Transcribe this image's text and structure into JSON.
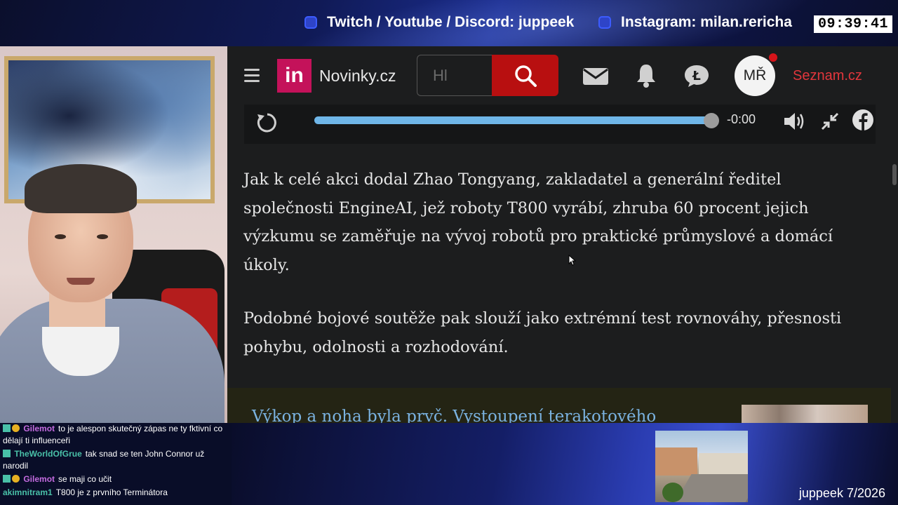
{
  "overlay": {
    "social_twitch": "Twitch / Youtube / Discord: juppeek",
    "social_instagram": "Instagram: milan.rericha",
    "clock": "09:39:41",
    "footer_tag": "juppeek 7/2026",
    "accent": "#2e44c8"
  },
  "browser": {
    "logo_mark": "in",
    "logo_text": "Novinky.cz",
    "search_placeholder": "Hl",
    "avatar_initials": "MŘ",
    "seznam_link": "Seznam.cz",
    "icons": [
      "menu-icon",
      "search-icon",
      "mail-icon",
      "bell-icon",
      "lide-icon",
      "replay-icon",
      "volume-icon",
      "collapse-icon",
      "facebook-icon"
    ],
    "accent": "#b80f10",
    "brand": "#c4125a"
  },
  "player": {
    "time": "-0:00",
    "progress_percent": 100
  },
  "article": {
    "paragraphs": [
      "Jak k celé akci dodal Zhao Tongyang, zakladatel a generální ředitel společnosti EngineAI, jež roboty T800 vyrábí, zhruba 60 procent jejich výzkumu se zaměřuje na vývoj robotů pro praktické průmyslové a domácí úkoly.",
      "Podobné bojové soutěže pak slouží jako extrémní test rovnováhy, přesnosti pohybu, odolnosti a rozhodování."
    ],
    "related_title": "Výkop a noha byla prvč. Vystoupení terakotového"
  },
  "chat": {
    "messages": [
      {
        "user": "Gilemot",
        "user_color": "#c46be0",
        "text": "to je alespon skutečný zápas ne ty fktivní co dělají ti influenceři",
        "badges": [
          "sub",
          "bits"
        ]
      },
      {
        "user": "TheWorldOfGrue",
        "user_color": "#49c0a8",
        "text": "tak snad se ten John Connor už narodil",
        "badges": [
          "sub"
        ]
      },
      {
        "user": "Gilemot",
        "user_color": "#c46be0",
        "text": "se maji co učit",
        "badges": [
          "sub",
          "bits"
        ]
      },
      {
        "user": "akimnitram1",
        "user_color": "#49c0a8",
        "text": "T800 je z prvního Terminátora",
        "badges": []
      }
    ]
  }
}
